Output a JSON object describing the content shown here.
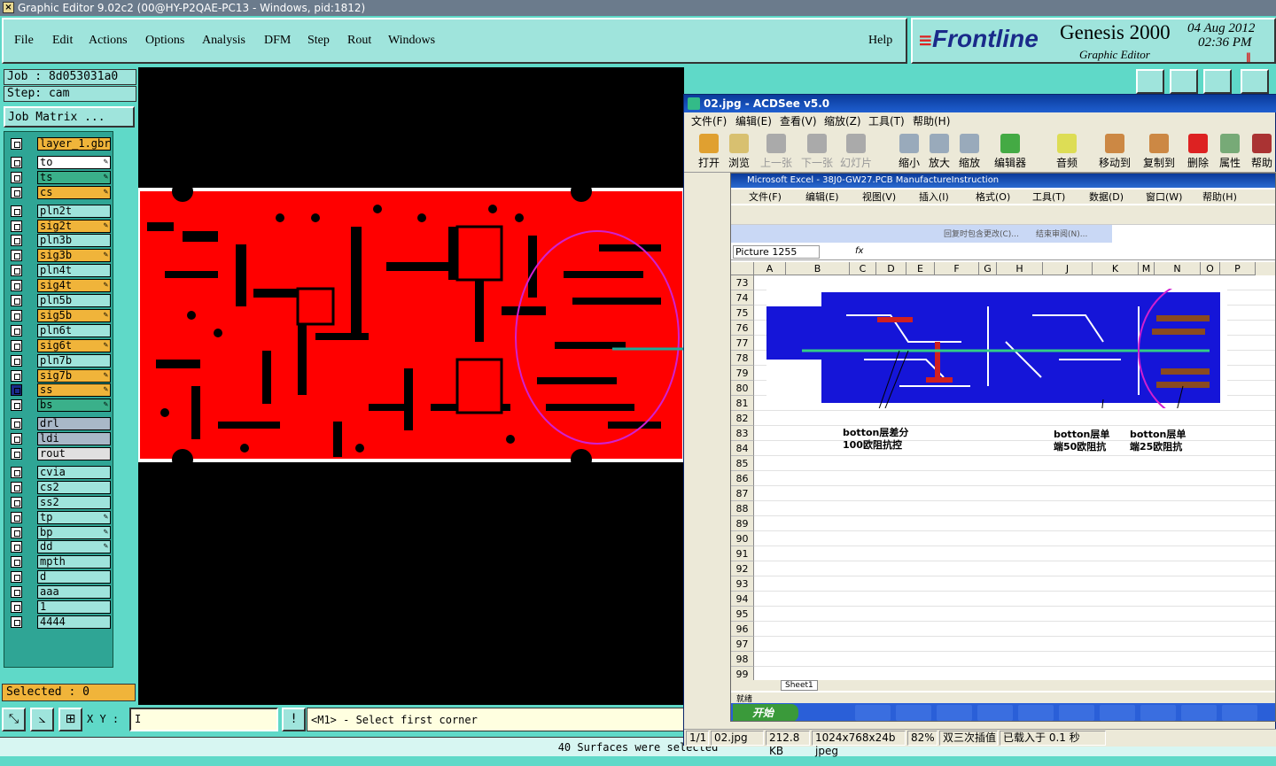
{
  "window": {
    "title": "Graphic Editor 9.02c2 (00@HY-P2QAE-PC13 - Windows, pid:1812)"
  },
  "menu": {
    "file": "File",
    "edit": "Edit",
    "actions": "Actions",
    "options": "Options",
    "analysis": "Analysis",
    "dfm": "DFM",
    "step": "Step",
    "rout": "Rout",
    "windows": "Windows",
    "help": "Help"
  },
  "brand": {
    "logo": "Frontline",
    "product": "Genesis 2000",
    "subtitle": "Graphic Editor",
    "date": "04 Aug 2012",
    "time": "02:36 PM"
  },
  "job": {
    "job_label": "Job : 8d053031a0",
    "step_label": "Step: cam",
    "matrix_button": "Job Matrix ..."
  },
  "layers": [
    {
      "name": "layer_1.gbr",
      "color": "#f0b43a",
      "pen": false
    },
    {
      "name": "to",
      "color": "#ffffff",
      "pen": true
    },
    {
      "name": "ts",
      "color": "#3ab08a",
      "pen": true
    },
    {
      "name": "cs",
      "color": "#f0b43a",
      "pen": true
    },
    {
      "name": "pln2t",
      "color": "#9fe4dc",
      "pen": false
    },
    {
      "name": "sig2t",
      "color": "#f0b43a",
      "pen": true
    },
    {
      "name": "pln3b",
      "color": "#9fe4dc",
      "pen": false
    },
    {
      "name": "sig3b",
      "color": "#f0b43a",
      "pen": true
    },
    {
      "name": "pln4t",
      "color": "#9fe4dc",
      "pen": false
    },
    {
      "name": "sig4t",
      "color": "#f0b43a",
      "pen": true
    },
    {
      "name": "pln5b",
      "color": "#9fe4dc",
      "pen": false
    },
    {
      "name": "sig5b",
      "color": "#f0b43a",
      "pen": true
    },
    {
      "name": "pln6t",
      "color": "#9fe4dc",
      "pen": false
    },
    {
      "name": "sig6t",
      "color": "#f0b43a",
      "pen": true
    },
    {
      "name": "pln7b",
      "color": "#9fe4dc",
      "pen": false
    },
    {
      "name": "sig7b",
      "color": "#f0b43a",
      "pen": true
    },
    {
      "name": "ss",
      "color": "#f0b43a",
      "pen": true
    },
    {
      "name": "bs",
      "color": "#3ab08a",
      "pen": true
    },
    {
      "name": "drl",
      "color": "#a9b8c8",
      "pen": false
    },
    {
      "name": "ldi",
      "color": "#a9b8c8",
      "pen": false
    },
    {
      "name": "rout",
      "color": "#e0e0e0",
      "pen": false
    },
    {
      "name": "cvia",
      "color": "#9fe4dc",
      "pen": false
    },
    {
      "name": "cs2",
      "color": "#9fe4dc",
      "pen": false
    },
    {
      "name": "ss2",
      "color": "#9fe4dc",
      "pen": false
    },
    {
      "name": "tp",
      "color": "#9fe4dc",
      "pen": true
    },
    {
      "name": "bp",
      "color": "#9fe4dc",
      "pen": true
    },
    {
      "name": "dd",
      "color": "#9fe4dc",
      "pen": true
    },
    {
      "name": "mpth",
      "color": "#9fe4dc",
      "pen": false
    },
    {
      "name": "d",
      "color": "#9fe4dc",
      "pen": false
    },
    {
      "name": "aaa",
      "color": "#9fe4dc",
      "pen": false
    },
    {
      "name": "1",
      "color": "#9fe4dc",
      "pen": false
    },
    {
      "name": "4444",
      "color": "#9fe4dc",
      "pen": false
    }
  ],
  "selected": "Selected : 0",
  "coord": {
    "label": "X Y :",
    "value": "I"
  },
  "prompt": "<M1> - Select first corner",
  "status": "40 Surfaces were selected",
  "acdsee": {
    "title": "02.jpg - ACDSee v5.0",
    "menu": [
      "文件(F)",
      "编辑(E)",
      "查看(V)",
      "缩放(Z)",
      "工具(T)",
      "帮助(H)"
    ],
    "tools": [
      {
        "label": "打开",
        "icon": "open-icon",
        "disabled": false
      },
      {
        "label": "浏览",
        "icon": "browse-icon",
        "disabled": false
      },
      {
        "label": "上一张",
        "icon": "prev-icon",
        "disabled": true
      },
      {
        "label": "下一张",
        "icon": "next-icon",
        "disabled": true
      },
      {
        "label": "幻灯片",
        "icon": "slideshow-icon",
        "disabled": true
      },
      {
        "label": "缩小",
        "icon": "zoom-out-icon",
        "disabled": false
      },
      {
        "label": "放大",
        "icon": "zoom-in-icon",
        "disabled": false
      },
      {
        "label": "缩放",
        "icon": "zoom-icon",
        "disabled": false
      },
      {
        "label": "编辑器",
        "icon": "editor-icon",
        "disabled": false
      },
      {
        "label": "音频",
        "icon": "audio-icon",
        "disabled": false
      },
      {
        "label": "移动到",
        "icon": "move-icon",
        "disabled": false
      },
      {
        "label": "复制到",
        "icon": "copy-icon",
        "disabled": false
      },
      {
        "label": "删除",
        "icon": "delete-icon",
        "disabled": false
      },
      {
        "label": "属性",
        "icon": "properties-icon",
        "disabled": false
      },
      {
        "label": "帮助",
        "icon": "help-icon",
        "disabled": false
      }
    ],
    "status": {
      "page": "1/1",
      "file": "02.jpg",
      "size": "212.8 KB",
      "dims": "1024x768x24b jpeg",
      "zoom": "82%",
      "mode": "双三次插值",
      "load": "已载入于 0.1 秒"
    }
  },
  "excel": {
    "title": "Microsoft Excel - 38J0-GW27.PCB ManufactureInstruction",
    "menu": [
      "文件(F)",
      "编辑(E)",
      "视图(V)",
      "插入(I)",
      "格式(O)",
      "工具(T)",
      "数据(D)",
      "窗口(W)",
      "帮助(H)"
    ],
    "review_text": "回复时包含更改(C)...",
    "review_end": "结束审阅(N)...",
    "name_box": "Picture 1255",
    "fx": "fx",
    "columns": [
      "A",
      "B",
      "C",
      "D",
      "E",
      "F",
      "G",
      "H",
      "J",
      "K",
      "M",
      "N",
      "O",
      "P"
    ],
    "rows": [
      "73",
      "74",
      "75",
      "76",
      "77",
      "78",
      "79",
      "80",
      "81",
      "82",
      "83",
      "84",
      "85",
      "86",
      "87",
      "88",
      "89",
      "90",
      "91",
      "92",
      "93",
      "94",
      "95",
      "96",
      "97",
      "98",
      "99"
    ],
    "annot1": "botton层差分\n100欧阻抗控",
    "annot2": "botton层单\n端50欧阻抗",
    "annot3": "botton层单\n端25欧阻抗",
    "sheet_tab": "Sheet1",
    "ready": "就绪",
    "start": "开始"
  }
}
